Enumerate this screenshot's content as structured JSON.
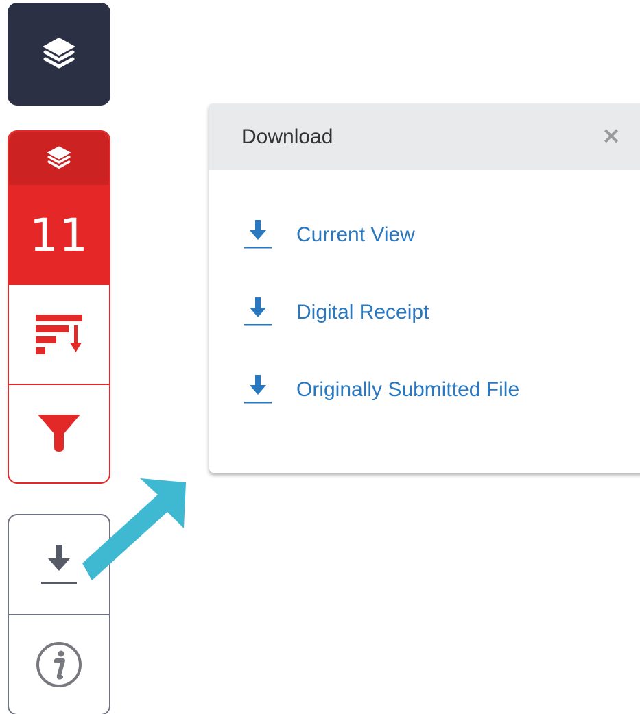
{
  "sidebar": {
    "layers_icon": "layers-icon",
    "similarity": {
      "icon": "layers-icon",
      "score": "11"
    },
    "sort_icon": "sort-icon",
    "filter_icon": "filter-icon",
    "download_icon": "download-icon",
    "info_icon": "info-icon"
  },
  "download_popup": {
    "title": "Download",
    "close_label": "×",
    "items": [
      {
        "label": "Current View",
        "icon": "download-icon"
      },
      {
        "label": "Digital Receipt",
        "icon": "download-icon"
      },
      {
        "label": "Originally Submitted File",
        "icon": "download-icon"
      }
    ]
  },
  "colors": {
    "dark_button": "#2b3044",
    "red_header": "#cc2222",
    "red_score": "#e52827",
    "link_blue": "#2a78bf",
    "popup_header": "#e9eaeb",
    "callout_arrow": "#3fb8d2",
    "tool_border": "#6f7280"
  }
}
